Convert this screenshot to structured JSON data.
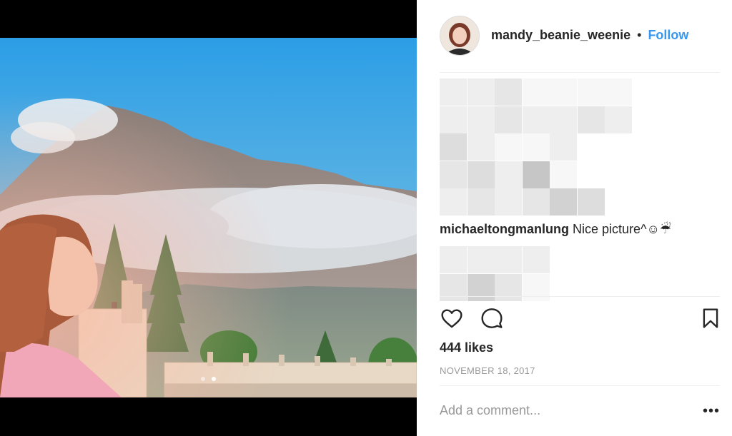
{
  "post": {
    "username": "mandy_beanie_weenie",
    "separator": "•",
    "follow_label": "Follow"
  },
  "comments": [
    {
      "user": "michaeltongmanlung",
      "text": "Nice picture^☺☔"
    }
  ],
  "stats": {
    "likes": "444 likes",
    "date": "NOVEMBER 18, 2017"
  },
  "comment_input": {
    "placeholder": "Add a comment..."
  },
  "more_label": "•••",
  "icons": {
    "like": "heart-icon",
    "comment": "comment-bubble-icon",
    "save": "bookmark-icon"
  },
  "carousel": {
    "current": 2,
    "total": 2
  },
  "colors": {
    "follow": "#3897f0",
    "text": "#262626",
    "muted": "#999999"
  }
}
